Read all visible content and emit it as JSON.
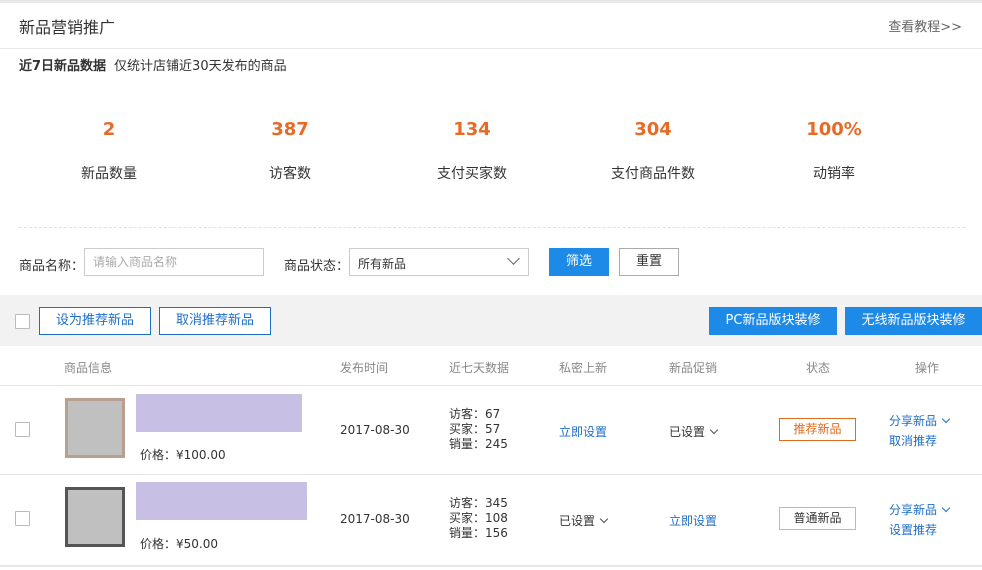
{
  "header": {
    "title": "新品营销推广",
    "tutorial_link": "查看教程>>"
  },
  "stats": {
    "caption_bold": "近7日新品数据",
    "caption_note": "仅统计店铺近30天发布的商品",
    "items": [
      {
        "value": "2",
        "label": "新品数量"
      },
      {
        "value": "387",
        "label": "访客数"
      },
      {
        "value": "134",
        "label": "支付买家数"
      },
      {
        "value": "304",
        "label": "支付商品件数"
      },
      {
        "value": "100%",
        "label": "动销率"
      }
    ]
  },
  "filters": {
    "name_label": "商品名称：",
    "name_placeholder": "请输入商品名称",
    "status_label": "商品状态：",
    "status_value": "所有新品",
    "filter_button": "筛选",
    "reset_button": "重置"
  },
  "toolbar": {
    "set_recommend": "设为推荐新品",
    "cancel_recommend": "取消推荐新品",
    "pc_decorate": "PC新品版块装修",
    "mobile_decorate": "无线新品版块装修"
  },
  "table": {
    "columns": [
      "商品信息",
      "发布时间",
      "近七天数据",
      "私密上新",
      "新品促销",
      "状态",
      "操作"
    ],
    "rows": [
      {
        "price": "价格：¥100.00",
        "date": "2017-08-30",
        "visitors": "访客：67",
        "buyers": "买家：57",
        "sales": "销量：245",
        "private_launch": "立即设置",
        "promotion": "已设置",
        "status": "推荐新品",
        "action_share": "分享新品",
        "action_toggle": "取消推荐"
      },
      {
        "price": "价格：¥50.00",
        "date": "2017-08-30",
        "visitors": "访客：345",
        "buyers": "买家：108",
        "sales": "销量：156",
        "private_launch": "已设置",
        "promotion": "立即设置",
        "status": "普通新品",
        "action_share": "分享新品",
        "action_toggle": "设置推荐"
      }
    ]
  },
  "colors": {
    "accent": "#1e8ae8",
    "highlight": "#e86a27",
    "link": "#1e6ec8"
  }
}
